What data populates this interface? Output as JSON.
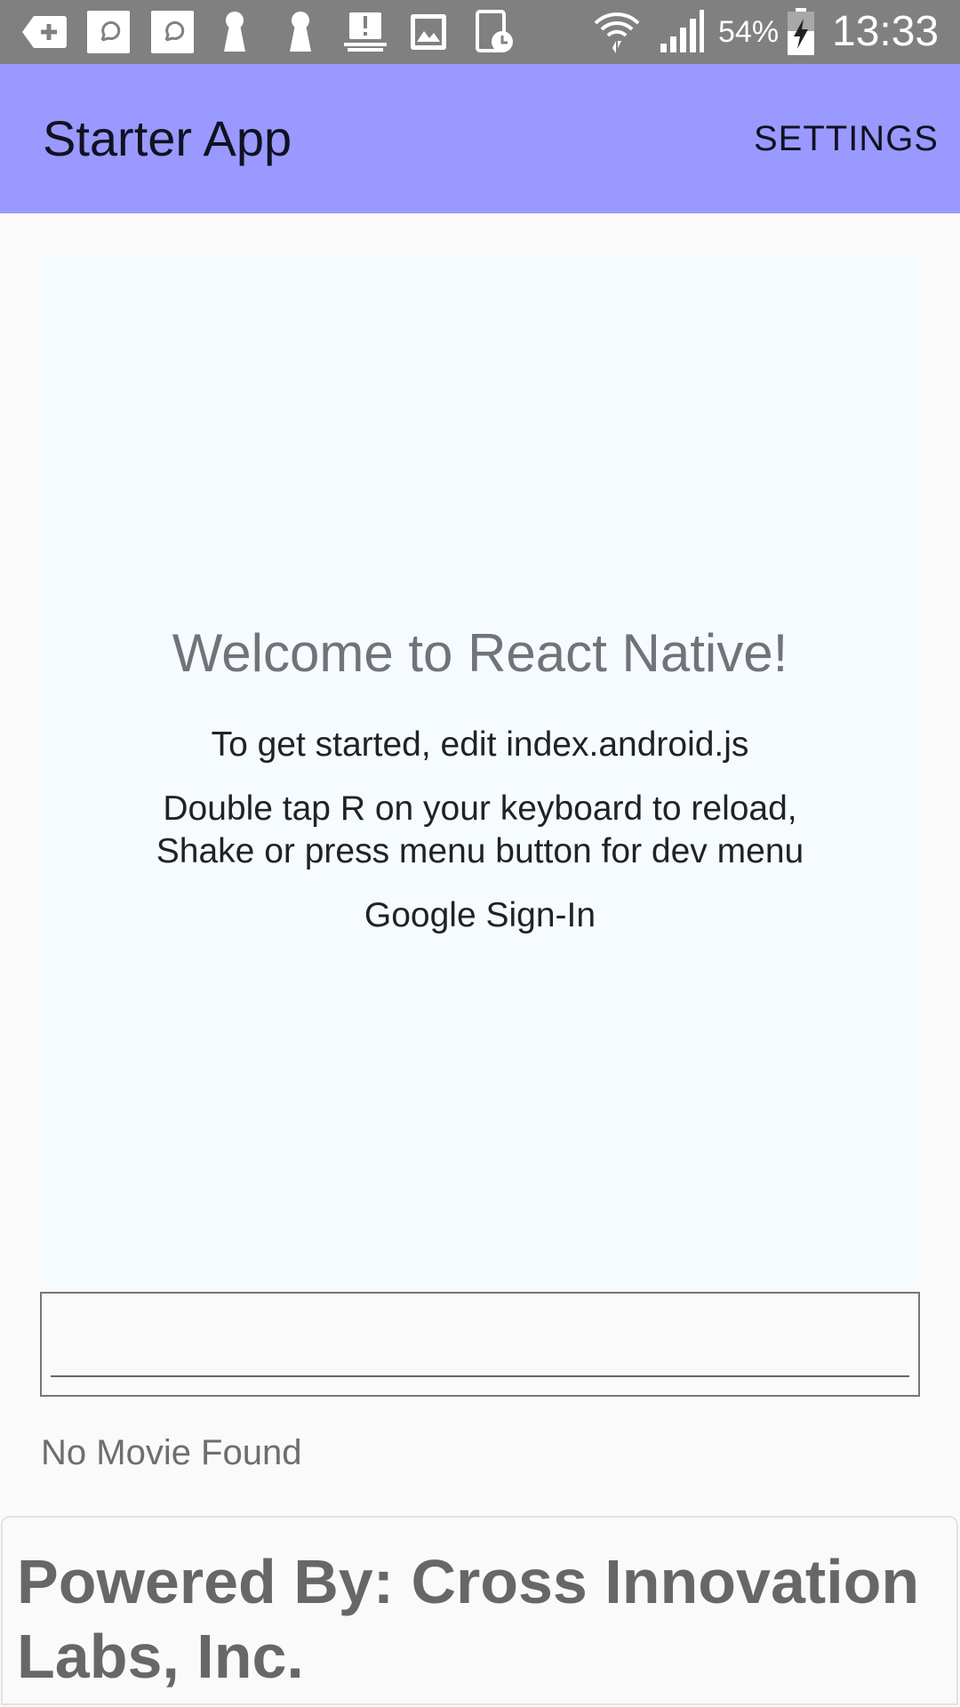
{
  "status_bar": {
    "battery_percent": "54%",
    "time": "13:33",
    "icons": [
      "add-box-icon",
      "chat-icon",
      "chat-icon",
      "keyhole-icon",
      "keyhole-icon",
      "alert-tray-icon",
      "image-icon",
      "timer-device-icon",
      "wifi-icon",
      "signal-icon",
      "battery-charging-icon"
    ]
  },
  "app_bar": {
    "title": "Starter App",
    "settings_label": "SETTINGS",
    "color": "#9999ff"
  },
  "welcome": {
    "title": "Welcome to React Native!",
    "instruction_1": "To get started, edit index.android.js",
    "instruction_2": "Double tap R on your keyboard to reload,",
    "instruction_3": "Shake or press menu button for dev menu",
    "google_signin": "Google Sign-In",
    "background": "#f5fbff"
  },
  "search": {
    "value": "",
    "placeholder": ""
  },
  "results": {
    "status_text": "No Movie Found"
  },
  "footer": {
    "text": "Powered By: Cross Innovation Labs, Inc."
  }
}
